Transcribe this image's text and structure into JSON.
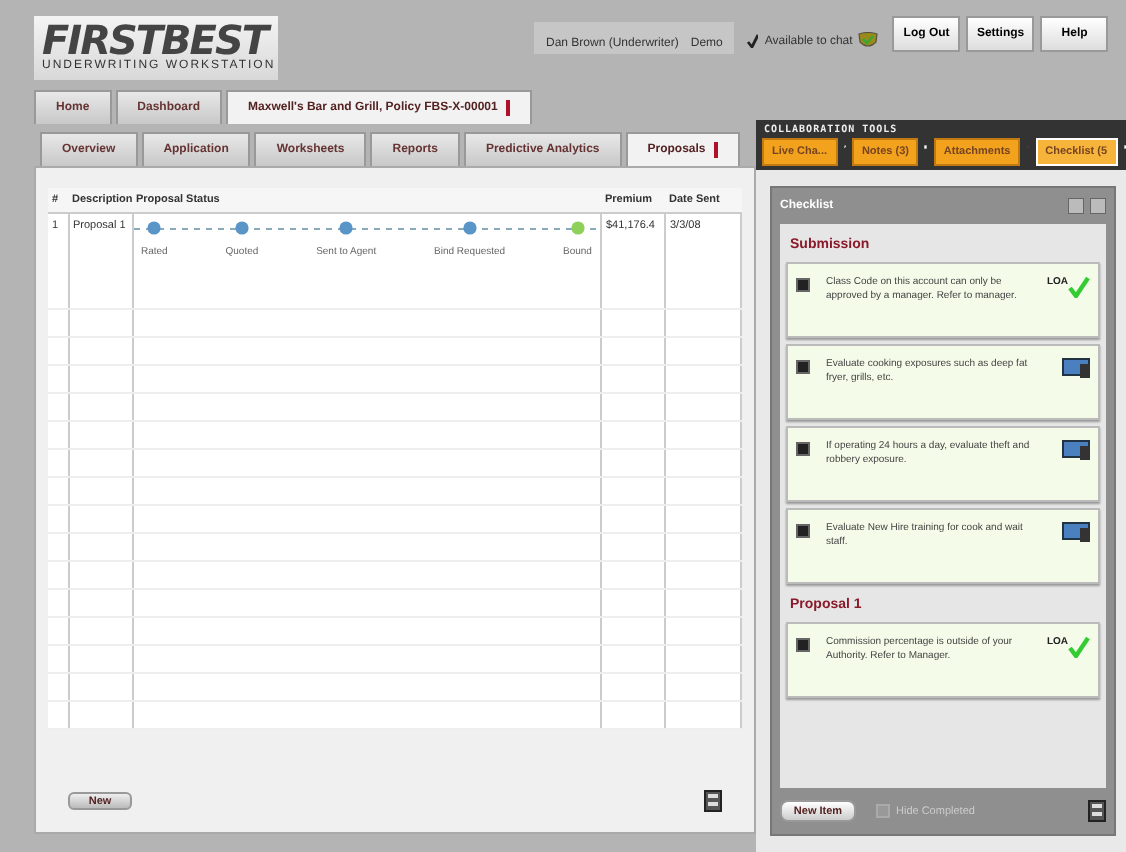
{
  "header": {
    "logo": "FIRSTBEST",
    "logo_subtitle": "UNDERWRITING WORKSTATION",
    "user": "Dan Brown (Underwriter)",
    "environment": "Demo",
    "available_to_chat": {
      "label": "Available to chat",
      "checked": true
    },
    "buttons": [
      "Log Out",
      "Settings",
      "Help"
    ]
  },
  "top_tabs": [
    {
      "label": "Home",
      "selected": false
    },
    {
      "label": "Dashboard",
      "selected": false
    },
    {
      "label": "Maxwell's Bar and Grill, Policy FBS-X-00001",
      "selected": true
    }
  ],
  "policy_tabs": [
    {
      "label": "Overview",
      "selected": false
    },
    {
      "label": "Application",
      "selected": false
    },
    {
      "label": "Worksheets",
      "selected": false
    },
    {
      "label": "Reports",
      "selected": false
    },
    {
      "label": "Predictive Analytics",
      "selected": false
    },
    {
      "label": "Proposals",
      "selected": true
    }
  ],
  "table": {
    "columns": [
      "#",
      "Description",
      "Proposal Status",
      "Premium",
      "Date Sent"
    ],
    "rows": [
      {
        "number": "1",
        "description": "Proposal 1",
        "premium": "$41,176.4",
        "date_sent": "3/3/08",
        "status_steps": [
          {
            "label": "Rated",
            "kind": "complete"
          },
          {
            "label": "Quoted",
            "kind": "complete"
          },
          {
            "label": "Sent to Agent",
            "kind": "complete"
          },
          {
            "label": "Bind Requested",
            "kind": "complete"
          },
          {
            "label": "Bound",
            "kind": "current"
          }
        ]
      }
    ]
  },
  "new_button": "New",
  "collaboration": {
    "title": "COLLABORATION TOOLS",
    "tabs": [
      {
        "label": "Live Cha...",
        "selected": false
      },
      {
        "label": "Notes (3)",
        "selected": false
      },
      {
        "label": "Attachments",
        "selected": false
      },
      {
        "label": "Checklist (5",
        "selected": true
      }
    ]
  },
  "checklist": {
    "title": "Checklist",
    "sections": [
      {
        "title": "Submission",
        "items": [
          {
            "text": "Class Code on this account can only be approved by a manager.  Refer to manager.",
            "checked": true,
            "kind": "loa",
            "badge": "LOA"
          },
          {
            "text": "Evaluate cooking exposures such as deep fat fryer, grills, etc.",
            "checked": true,
            "kind": "monitor"
          },
          {
            "text": "If operating 24 hours a day, evaluate theft and robbery exposure.",
            "checked": true,
            "kind": "monitor"
          },
          {
            "text": "Evaluate New Hire training for cook and wait staff.",
            "checked": true,
            "kind": "monitor"
          }
        ]
      },
      {
        "title": "Proposal 1",
        "items": [
          {
            "text": "Commission percentage is outside of your Authority.  Refer to Manager.",
            "checked": true,
            "kind": "loa",
            "badge": "LOA"
          }
        ]
      }
    ],
    "new_item_button": "New Item",
    "hide_completed": {
      "label": "Hide Completed",
      "checked": false
    }
  }
}
